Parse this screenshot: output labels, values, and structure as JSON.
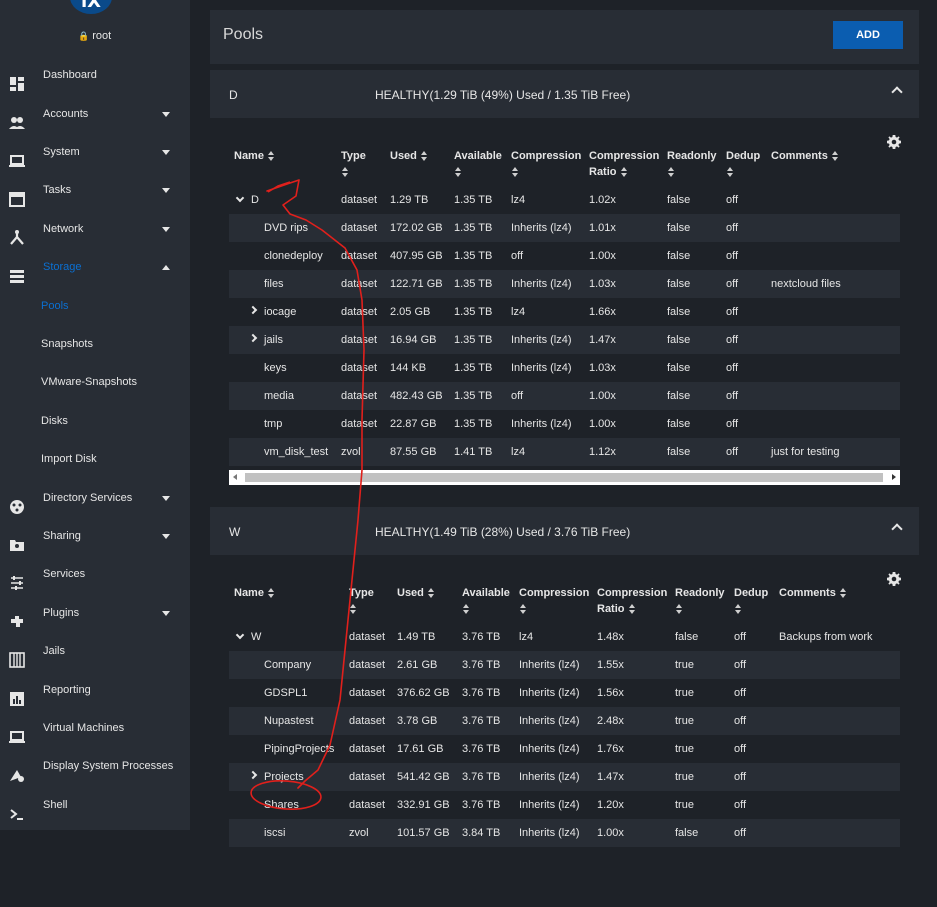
{
  "user": {
    "name": "root"
  },
  "logo": {
    "text": "iX"
  },
  "sidebar": {
    "items": [
      {
        "label": "Dashboard",
        "icon": "dashboard-icon",
        "caret": false
      },
      {
        "label": "Accounts",
        "icon": "accounts-icon",
        "caret": true
      },
      {
        "label": "System",
        "icon": "laptop-icon",
        "caret": true
      },
      {
        "label": "Tasks",
        "icon": "calendar-icon",
        "caret": true
      },
      {
        "label": "Network",
        "icon": "network-icon",
        "caret": true
      },
      {
        "label": "Storage",
        "icon": "storage-icon",
        "caret": true,
        "expanded": true,
        "active": true
      }
    ],
    "storage_sub": [
      "Pools",
      "Snapshots",
      "VMware-Snapshots",
      "Disks",
      "Import Disk"
    ],
    "items_after": [
      {
        "label": "Directory Services",
        "icon": "directory-icon",
        "caret": true
      },
      {
        "label": "Sharing",
        "icon": "sharing-icon",
        "caret": true
      },
      {
        "label": "Services",
        "icon": "services-icon",
        "caret": false
      },
      {
        "label": "Plugins",
        "icon": "plugins-icon",
        "caret": true
      },
      {
        "label": "Jails",
        "icon": "jails-icon",
        "caret": false
      },
      {
        "label": "Reporting",
        "icon": "reporting-icon",
        "caret": false
      },
      {
        "label": "Virtual Machines",
        "icon": "vm-icon",
        "caret": false
      },
      {
        "label": "Display System Processes",
        "icon": "processes-icon",
        "caret": false
      },
      {
        "label": "Shell",
        "icon": "shell-icon",
        "caret": false
      }
    ]
  },
  "main": {
    "title": "Pools",
    "add_label": "ADD"
  },
  "columns": {
    "name": "Name",
    "type": "Type",
    "used": "Used",
    "available": "Available",
    "compression": "Compression",
    "ratio1": "Compression",
    "ratio2": "Ratio",
    "readonly": "Readonly",
    "dedup": "Dedup",
    "comments": "Comments"
  },
  "pools": [
    {
      "name": "D",
      "status": "HEALTHY(1.29 TiB (49%) Used / 1.35 TiB Free)",
      "rows": [
        {
          "name": "D",
          "expander": "open",
          "indent": 0,
          "type": "dataset",
          "used": "1.29 TB",
          "available": "1.35 TB",
          "compression": "lz4",
          "ratio": "1.02x",
          "readonly": "false",
          "dedup": "off",
          "comments": ""
        },
        {
          "name": "DVD rips",
          "expander": "",
          "indent": 1,
          "type": "dataset",
          "used": "172.02 GB",
          "available": "1.35 TB",
          "compression": "Inherits (lz4)",
          "ratio": "1.01x",
          "readonly": "false",
          "dedup": "off",
          "comments": ""
        },
        {
          "name": "clonedeploy",
          "expander": "",
          "indent": 1,
          "type": "dataset",
          "used": "407.95 GB",
          "available": "1.35 TB",
          "compression": "off",
          "ratio": "1.00x",
          "readonly": "false",
          "dedup": "off",
          "comments": ""
        },
        {
          "name": "files",
          "expander": "",
          "indent": 1,
          "type": "dataset",
          "used": "122.71 GB",
          "available": "1.35 TB",
          "compression": "Inherits (lz4)",
          "ratio": "1.03x",
          "readonly": "false",
          "dedup": "off",
          "comments": "nextcloud files"
        },
        {
          "name": "iocage",
          "expander": "closed",
          "indent": 1,
          "type": "dataset",
          "used": "2.05 GB",
          "available": "1.35 TB",
          "compression": "lz4",
          "ratio": "1.66x",
          "readonly": "false",
          "dedup": "off",
          "comments": ""
        },
        {
          "name": "jails",
          "expander": "closed",
          "indent": 1,
          "type": "dataset",
          "used": "16.94 GB",
          "available": "1.35 TB",
          "compression": "Inherits (lz4)",
          "ratio": "1.47x",
          "readonly": "false",
          "dedup": "off",
          "comments": ""
        },
        {
          "name": "keys",
          "expander": "",
          "indent": 1,
          "type": "dataset",
          "used": "144 KB",
          "available": "1.35 TB",
          "compression": "Inherits (lz4)",
          "ratio": "1.03x",
          "readonly": "false",
          "dedup": "off",
          "comments": ""
        },
        {
          "name": "media",
          "expander": "",
          "indent": 1,
          "type": "dataset",
          "used": "482.43 GB",
          "available": "1.35 TB",
          "compression": "off",
          "ratio": "1.00x",
          "readonly": "false",
          "dedup": "off",
          "comments": ""
        },
        {
          "name": "tmp",
          "expander": "",
          "indent": 1,
          "type": "dataset",
          "used": "22.87 GB",
          "available": "1.35 TB",
          "compression": "Inherits (lz4)",
          "ratio": "1.00x",
          "readonly": "false",
          "dedup": "off",
          "comments": ""
        },
        {
          "name": "vm_disk_test",
          "expander": "",
          "indent": 1,
          "type": "zvol",
          "used": "87.55 GB",
          "available": "1.41 TB",
          "compression": "lz4",
          "ratio": "1.12x",
          "readonly": "false",
          "dedup": "off",
          "comments": "just for testing"
        }
      ]
    },
    {
      "name": "W",
      "status": "HEALTHY(1.49 TiB (28%) Used / 3.76 TiB Free)",
      "rows": [
        {
          "name": "W",
          "expander": "open",
          "indent": 0,
          "type": "dataset",
          "used": "1.49 TB",
          "available": "3.76 TB",
          "compression": "lz4",
          "ratio": "1.48x",
          "readonly": "false",
          "dedup": "off",
          "comments": "Backups from work"
        },
        {
          "name": "Company",
          "expander": "",
          "indent": 1,
          "type": "dataset",
          "used": "2.61 GB",
          "available": "3.76 TB",
          "compression": "Inherits (lz4)",
          "ratio": "1.55x",
          "readonly": "true",
          "dedup": "off",
          "comments": ""
        },
        {
          "name": "GDSPL1",
          "expander": "",
          "indent": 1,
          "type": "dataset",
          "used": "376.62 GB",
          "available": "3.76 TB",
          "compression": "Inherits (lz4)",
          "ratio": "1.56x",
          "readonly": "true",
          "dedup": "off",
          "comments": ""
        },
        {
          "name": "Nupastest",
          "expander": "",
          "indent": 1,
          "type": "dataset",
          "used": "3.78 GB",
          "available": "3.76 TB",
          "compression": "Inherits (lz4)",
          "ratio": "2.48x",
          "readonly": "true",
          "dedup": "off",
          "comments": ""
        },
        {
          "name": "PipingProjects",
          "expander": "",
          "indent": 1,
          "type": "dataset",
          "used": "17.61 GB",
          "available": "3.76 TB",
          "compression": "Inherits (lz4)",
          "ratio": "1.76x",
          "readonly": "true",
          "dedup": "off",
          "comments": ""
        },
        {
          "name": "Projects",
          "expander": "closed",
          "indent": 1,
          "type": "dataset",
          "used": "541.42 GB",
          "available": "3.76 TB",
          "compression": "Inherits (lz4)",
          "ratio": "1.47x",
          "readonly": "true",
          "dedup": "off",
          "comments": ""
        },
        {
          "name": "Shares",
          "expander": "",
          "indent": 1,
          "type": "dataset",
          "used": "332.91 GB",
          "available": "3.76 TB",
          "compression": "Inherits (lz4)",
          "ratio": "1.20x",
          "readonly": "true",
          "dedup": "off",
          "comments": ""
        },
        {
          "name": "iscsi",
          "expander": "",
          "indent": 1,
          "type": "zvol",
          "used": "101.57 GB",
          "available": "3.84 TB",
          "compression": "Inherits (lz4)",
          "ratio": "1.00x",
          "readonly": "false",
          "dedup": "off",
          "comments": ""
        }
      ]
    }
  ],
  "colors": {
    "accent": "#0b5db0",
    "active_nav": "#0b6fd1",
    "annotation": "#e0201c"
  }
}
